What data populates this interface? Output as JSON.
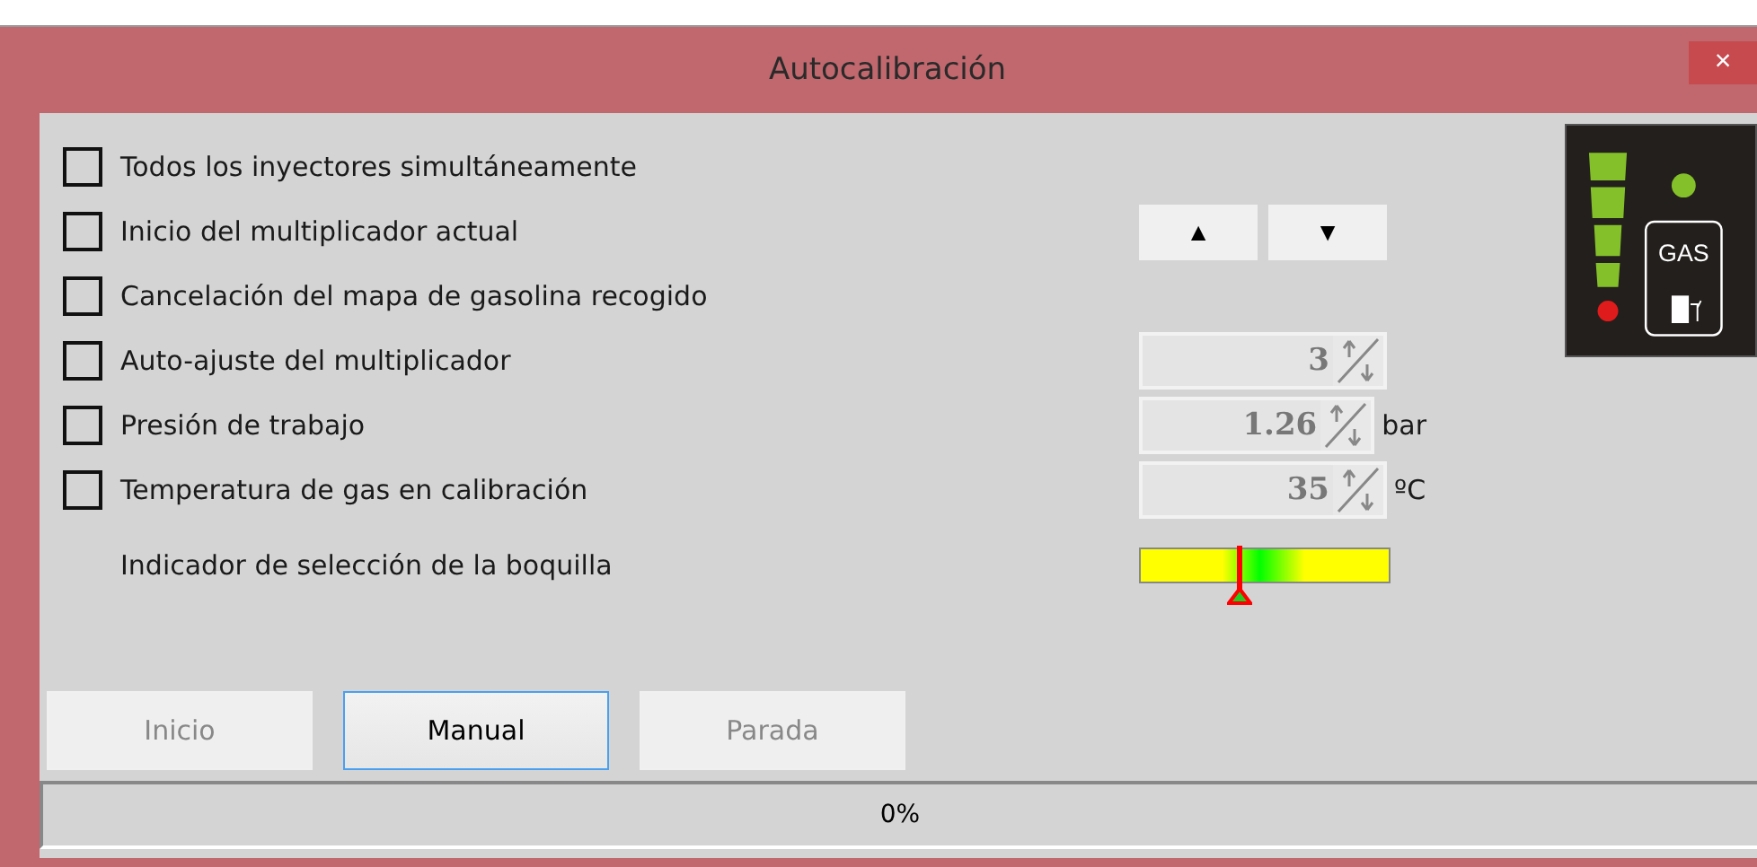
{
  "window": {
    "title": "Autocalibración",
    "close": "×"
  },
  "rows": [
    {
      "kind": "check",
      "label": "Todos los inyectores simultáneamente",
      "checked": false
    },
    {
      "kind": "arrows",
      "label": "Inicio del multiplicador actual",
      "checked": false,
      "buttons": [
        "▲",
        "▼"
      ]
    },
    {
      "kind": "check",
      "label": "Cancelación del mapa de gasolina recogido",
      "checked": false
    },
    {
      "kind": "spin",
      "label": "Auto-ajuste del multiplicador",
      "checked": false,
      "value": "3"
    },
    {
      "kind": "spin",
      "label": "Presión de trabajo",
      "checked": false,
      "value": "1.26",
      "unit": "bar"
    },
    {
      "kind": "spin",
      "label": "Temperatura de gas en calibración",
      "checked": false,
      "value": "35",
      "unit": "ºC"
    },
    {
      "kind": "indicator",
      "label": "Indicador de selección de la boquilla",
      "level": 0.4
    }
  ],
  "gas_panel": {
    "label": "GAS"
  },
  "buttons": [
    {
      "label": "Inicio",
      "disabled": true
    },
    {
      "label": "Manual",
      "disabled": false
    },
    {
      "label": "Parada",
      "disabled": true
    }
  ],
  "progress": {
    "text": "0%"
  }
}
